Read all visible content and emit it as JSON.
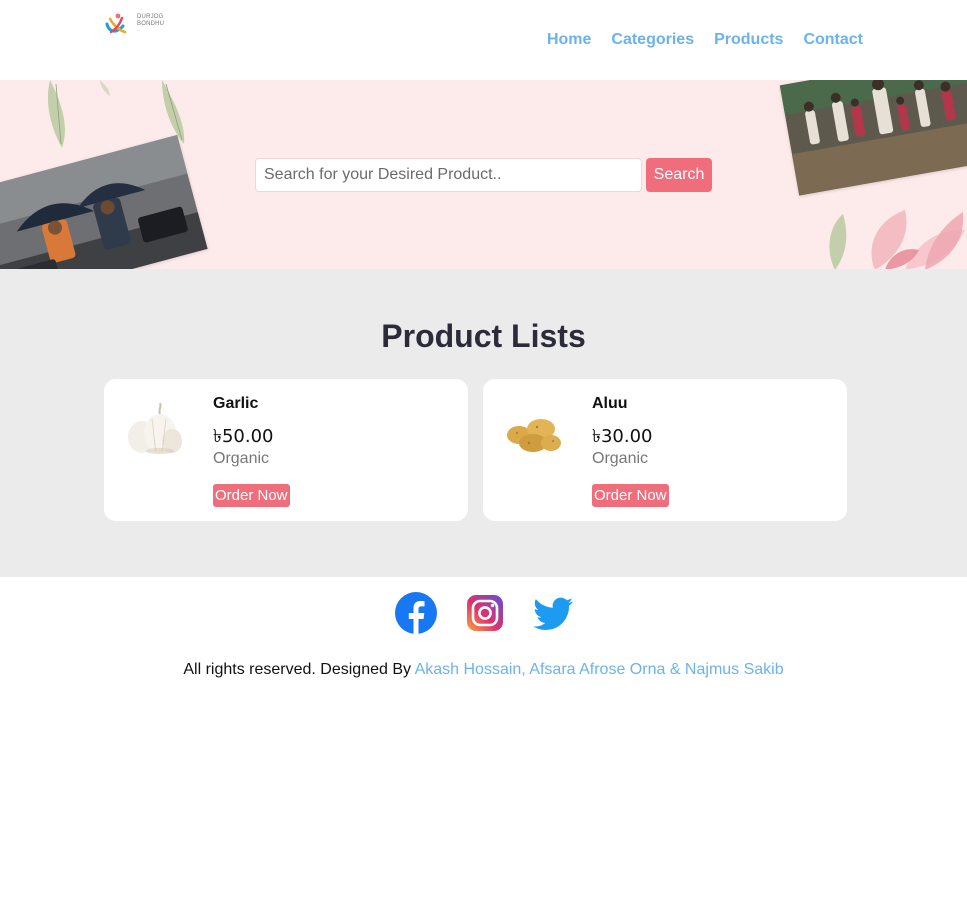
{
  "header": {
    "logo": {
      "line1": "DURJOG",
      "line2": "BONDHU",
      "line3": "—"
    },
    "nav": [
      {
        "label": "Home"
      },
      {
        "label": "Categories"
      },
      {
        "label": "Products"
      },
      {
        "label": "Contact"
      }
    ]
  },
  "hero": {
    "search": {
      "placeholder": "Search for your Desired Product..",
      "button_label": "Search"
    }
  },
  "products": {
    "title": "Product Lists",
    "items": [
      {
        "name": "Garlic",
        "price": "৳50.00",
        "tag": "Organic",
        "order_label": "Order Now",
        "image": "garlic"
      },
      {
        "name": "Aluu",
        "price": "৳30.00",
        "tag": "Organic",
        "order_label": "Order Now",
        "image": "potato"
      }
    ]
  },
  "footer": {
    "social": [
      "facebook-icon",
      "instagram-icon",
      "twitter-icon"
    ],
    "copyright_prefix": "All rights reserved. Designed By ",
    "authors": "Akash Hossain, Afsara Afrose Orna & Najmus Sakib"
  },
  "colors": {
    "accent": "#f06e7c",
    "link": "#6bb3ec",
    "hero_bg": "#fdebeb",
    "section_bg": "#ebebeb"
  }
}
